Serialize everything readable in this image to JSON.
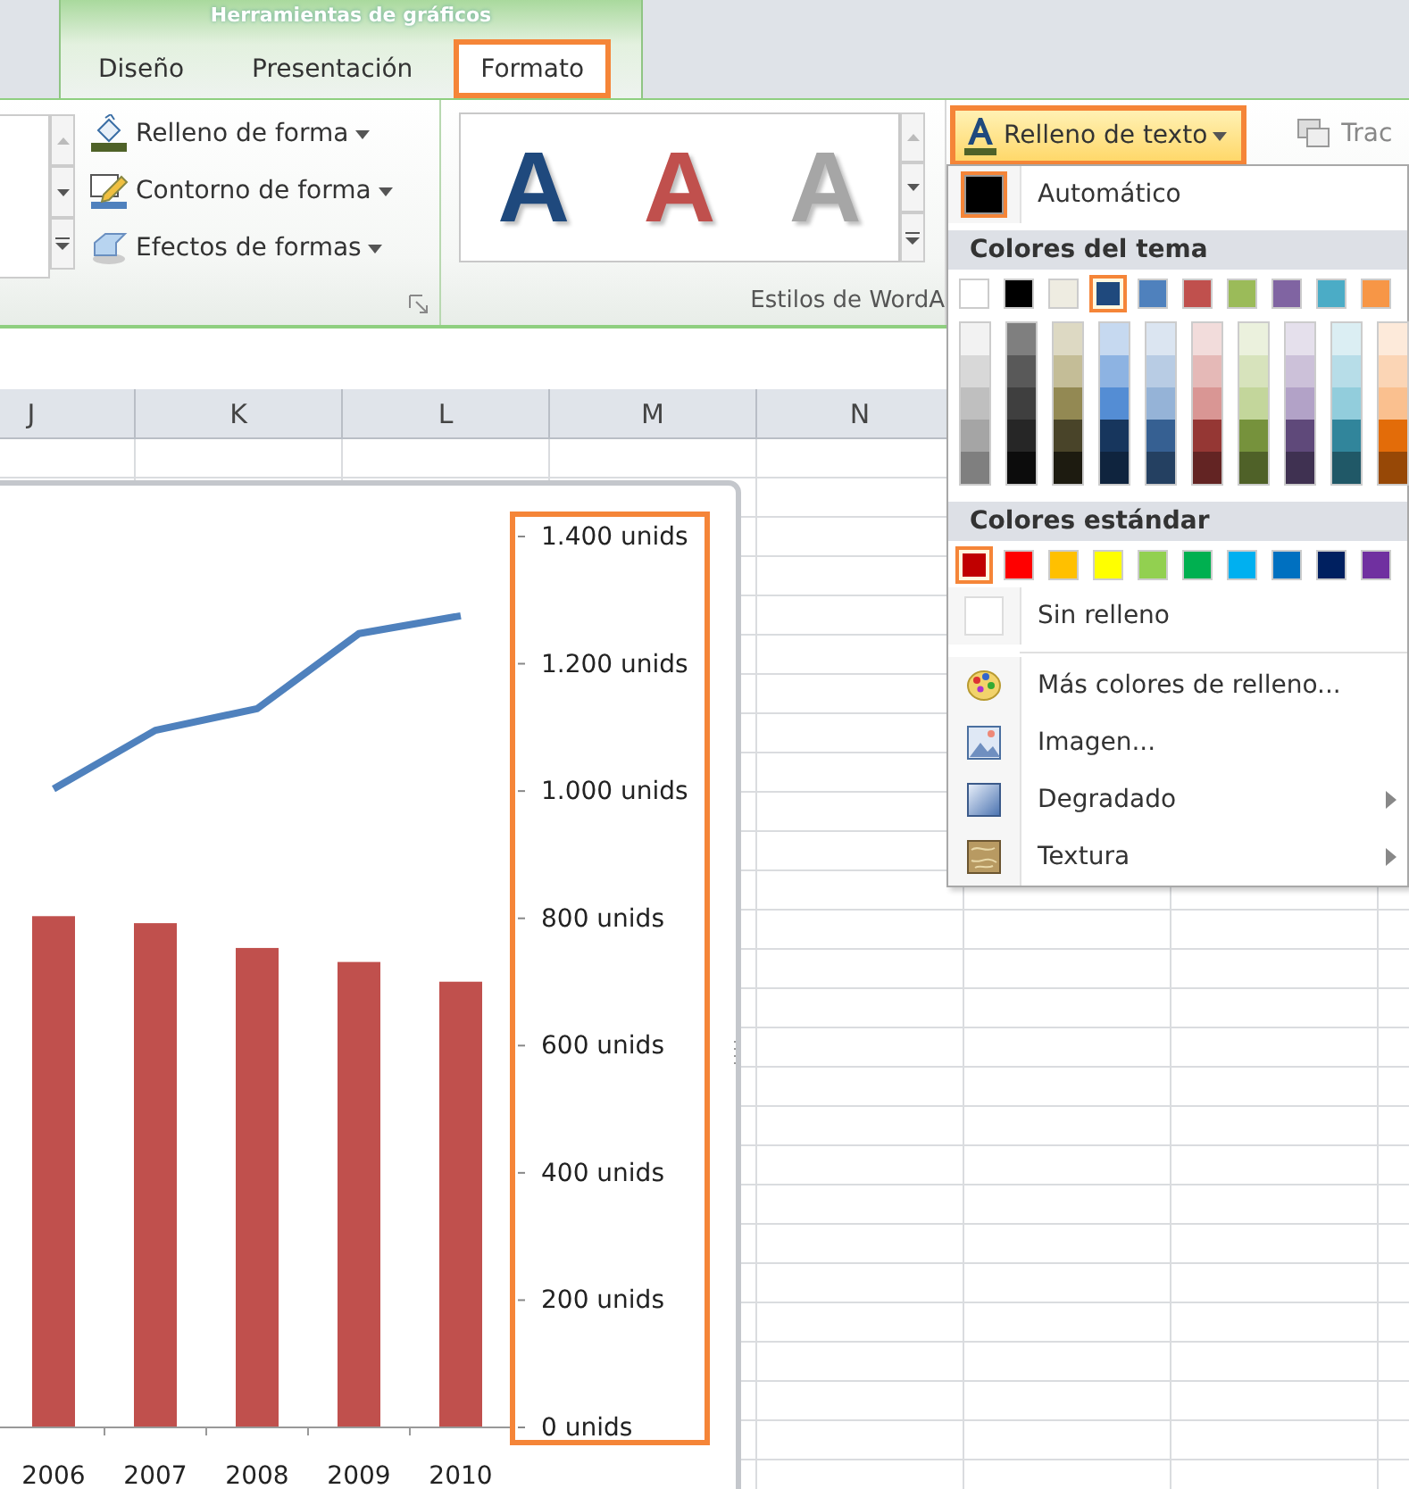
{
  "contextual_tab_group": {
    "title": "Herramientas de gráficos"
  },
  "tabs": [
    {
      "label": "Diseño",
      "selected": false
    },
    {
      "label": "Presentación",
      "selected": false
    },
    {
      "label": "Formato",
      "selected": true
    }
  ],
  "ribbon": {
    "shape_commands": [
      {
        "label": "Relleno de forma",
        "kind": "fill"
      },
      {
        "label": "Contorno de forma",
        "kind": "outline"
      },
      {
        "label": "Efectos de formas",
        "kind": "effects"
      }
    ],
    "wordart_styles": [
      {
        "letter": "A",
        "color": "#1f497d"
      },
      {
        "letter": "A",
        "color": "#c0504d"
      },
      {
        "letter": "A",
        "color": "#a6a6a6"
      }
    ],
    "wordart_group_label": "Estilos de WordA",
    "text_fill_button": {
      "label": "Relleno de texto",
      "pressed": true
    },
    "text_outline_button": {
      "label": "Trac"
    }
  },
  "sheet": {
    "columns": [
      "J",
      "K",
      "L",
      "M",
      "N"
    ]
  },
  "chart": {
    "chart_data": {
      "type": "bar",
      "categories": [
        "2006",
        "2007",
        "2008",
        "2009",
        "2010"
      ],
      "series": [
        {
          "type": "bar",
          "color": "#c0504d",
          "values": [
            802,
            791,
            752,
            730,
            699
          ]
        },
        {
          "type": "line",
          "color": "#4f81bd",
          "values": [
            1002,
            1094,
            1128,
            1246,
            1274
          ]
        }
      ],
      "ylim": [
        0,
        1400
      ],
      "yticks": [
        {
          "value": 0,
          "label": "0 unids"
        },
        {
          "value": 200,
          "label": "200 unids"
        },
        {
          "value": 400,
          "label": "400 unids"
        },
        {
          "value": 600,
          "label": "600 unids"
        },
        {
          "value": 800,
          "label": "800 unids"
        },
        {
          "value": 1000,
          "label": "1.000 unids"
        },
        {
          "value": 1200,
          "label": "1.200 unids"
        },
        {
          "value": 1400,
          "label": "1.400 unids"
        }
      ]
    }
  },
  "text_fill_menu": {
    "automatic": {
      "label": "Automático",
      "color": "#000000",
      "selected": true
    },
    "theme_heading": "Colores del tema",
    "theme_colors": [
      {
        "color": "#ffffff",
        "selected": false,
        "shades": [
          {
            "color": "#f2f2f2",
            "selected": false
          },
          {
            "color": "#d8d8d8",
            "selected": false
          },
          {
            "color": "#bfbfbf",
            "selected": false
          },
          {
            "color": "#a5a5a5",
            "selected": false
          },
          {
            "color": "#7f7f7f",
            "selected": false
          }
        ]
      },
      {
        "color": "#000000",
        "selected": false,
        "shades": [
          {
            "color": "#7f7f7f",
            "selected": false
          },
          {
            "color": "#595959",
            "selected": false
          },
          {
            "color": "#3f3f3f",
            "selected": false
          },
          {
            "color": "#262626",
            "selected": false
          },
          {
            "color": "#0c0c0c",
            "selected": false
          }
        ]
      },
      {
        "color": "#eeece1",
        "selected": false,
        "shades": [
          {
            "color": "#ddd9c3",
            "selected": false
          },
          {
            "color": "#c4bd97",
            "selected": false
          },
          {
            "color": "#938953",
            "selected": false
          },
          {
            "color": "#494429",
            "selected": false
          },
          {
            "color": "#1d1b10",
            "selected": false
          }
        ]
      },
      {
        "color": "#1f497d",
        "selected": true,
        "shades": [
          {
            "color": "#c6d9f0",
            "selected": false
          },
          {
            "color": "#8db3e2",
            "selected": false
          },
          {
            "color": "#548dd4",
            "selected": false
          },
          {
            "color": "#17365d",
            "selected": false
          },
          {
            "color": "#0f243e",
            "selected": false
          }
        ]
      },
      {
        "color": "#4f81bd",
        "selected": false,
        "shades": [
          {
            "color": "#dbe5f1",
            "selected": false
          },
          {
            "color": "#b8cce4",
            "selected": false
          },
          {
            "color": "#95b3d7",
            "selected": false
          },
          {
            "color": "#366092",
            "selected": false
          },
          {
            "color": "#244061",
            "selected": false
          }
        ]
      },
      {
        "color": "#c0504d",
        "selected": false,
        "shades": [
          {
            "color": "#f2dcdb",
            "selected": false
          },
          {
            "color": "#e5b9b7",
            "selected": false
          },
          {
            "color": "#d99694",
            "selected": false
          },
          {
            "color": "#953734",
            "selected": false
          },
          {
            "color": "#632423",
            "selected": false
          }
        ]
      },
      {
        "color": "#9bbb59",
        "selected": false,
        "shades": [
          {
            "color": "#ebf1dd",
            "selected": false
          },
          {
            "color": "#d7e3bc",
            "selected": false
          },
          {
            "color": "#c3d69b",
            "selected": false
          },
          {
            "color": "#76923c",
            "selected": false
          },
          {
            "color": "#4f6128",
            "selected": false
          }
        ]
      },
      {
        "color": "#8064a2",
        "selected": false,
        "shades": [
          {
            "color": "#e5e0ec",
            "selected": false
          },
          {
            "color": "#ccc1d9",
            "selected": false
          },
          {
            "color": "#b2a2c7",
            "selected": false
          },
          {
            "color": "#5f497a",
            "selected": false
          },
          {
            "color": "#3f3151",
            "selected": false
          }
        ]
      },
      {
        "color": "#4bacc6",
        "selected": false,
        "shades": [
          {
            "color": "#dbeef3",
            "selected": false
          },
          {
            "color": "#b7dde8",
            "selected": false
          },
          {
            "color": "#92cddc",
            "selected": false
          },
          {
            "color": "#31859b",
            "selected": false
          },
          {
            "color": "#205867",
            "selected": false
          }
        ]
      },
      {
        "color": "#f79646",
        "selected": false,
        "shades": [
          {
            "color": "#fdeada",
            "selected": false
          },
          {
            "color": "#fbd5b5",
            "selected": false
          },
          {
            "color": "#fac08f",
            "selected": false
          },
          {
            "color": "#e36c09",
            "selected": false
          },
          {
            "color": "#974806",
            "selected": false
          }
        ]
      }
    ],
    "standard_heading": "Colores estándar",
    "standard_colors": [
      {
        "color": "#c00000",
        "selected": true
      },
      {
        "color": "#ff0000",
        "selected": false
      },
      {
        "color": "#ffc000",
        "selected": false
      },
      {
        "color": "#ffff00",
        "selected": false
      },
      {
        "color": "#92d050",
        "selected": false
      },
      {
        "color": "#00b050",
        "selected": false
      },
      {
        "color": "#00b0f0",
        "selected": false
      },
      {
        "color": "#0070c0",
        "selected": false
      },
      {
        "color": "#002060",
        "selected": false
      },
      {
        "color": "#7030a0",
        "selected": false
      }
    ],
    "no_fill": {
      "label": "Sin relleno"
    },
    "commands": [
      {
        "label": "Más colores de relleno...",
        "kind": "palette",
        "submenu": false
      },
      {
        "label": "Imagen...",
        "kind": "picture",
        "submenu": false
      },
      {
        "label": "Degradado",
        "kind": "gradient",
        "submenu": true
      },
      {
        "label": "Textura",
        "kind": "texture",
        "submenu": true
      }
    ]
  }
}
